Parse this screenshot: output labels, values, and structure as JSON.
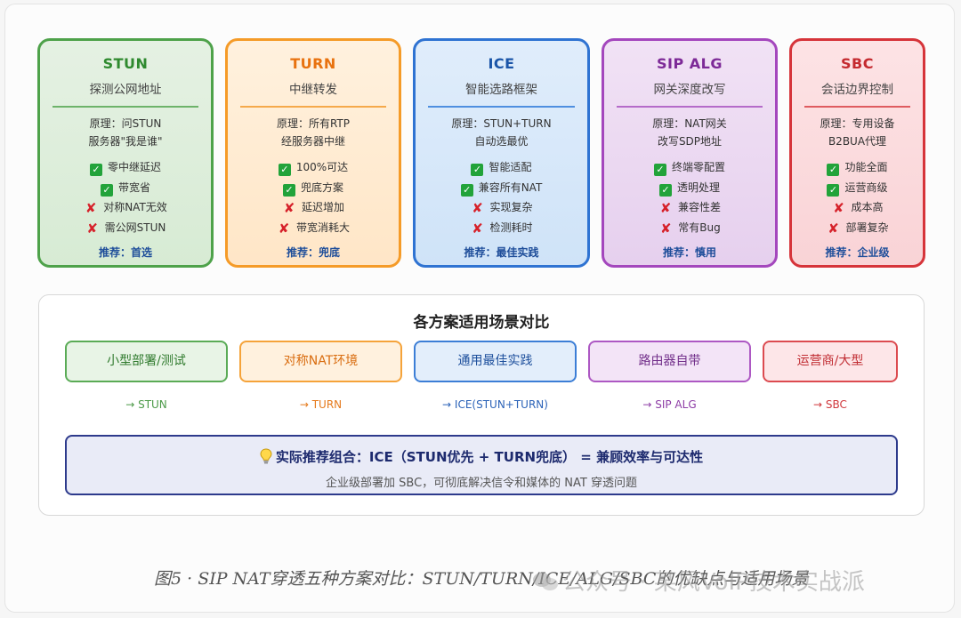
{
  "cards": [
    {
      "name": "STUN",
      "subtitle": "探测公网地址",
      "principle_1": "原理：问STUN",
      "principle_2": "服务器\"我是谁\"",
      "pros": [
        "零中继延迟",
        "带宽省"
      ],
      "cons": [
        "对称NAT无效",
        "需公网STUN"
      ],
      "recommend": "推荐：首选"
    },
    {
      "name": "TURN",
      "subtitle": "中继转发",
      "principle_1": "原理：所有RTP",
      "principle_2": "经服务器中继",
      "pros": [
        "100%可达",
        "兜底方案"
      ],
      "cons": [
        "延迟增加",
        "带宽消耗大"
      ],
      "recommend": "推荐：兜底"
    },
    {
      "name": "ICE",
      "subtitle": "智能选路框架",
      "principle_1": "原理：STUN+TURN",
      "principle_2": "自动选最优",
      "pros": [
        "智能适配",
        "兼容所有NAT"
      ],
      "cons": [
        "实现复杂",
        "检测耗时"
      ],
      "recommend": "推荐：最佳实践"
    },
    {
      "name": "SIP ALG",
      "subtitle": "网关深度改写",
      "principle_1": "原理：NAT网关",
      "principle_2": "改写SDP地址",
      "pros": [
        "终端零配置",
        "透明处理"
      ],
      "cons": [
        "兼容性差",
        "常有Bug"
      ],
      "recommend": "推荐：慎用"
    },
    {
      "name": "SBC",
      "subtitle": "会话边界控制",
      "principle_1": "原理：专用设备",
      "principle_2": "B2BUA代理",
      "pros": [
        "功能全面",
        "运营商级"
      ],
      "cons": [
        "成本高",
        "部署复杂"
      ],
      "recommend": "推荐：企业级"
    }
  ],
  "scenario": {
    "title": "各方案适用场景对比",
    "scenes": [
      "小型部署/测试",
      "对称NAT环境",
      "通用最佳实践",
      "路由器自带",
      "运营商/大型"
    ],
    "arrows": [
      "→ STUN",
      "→ TURN",
      "→ ICE(STUN+TURN)",
      "→ SIP ALG",
      "→ SBC"
    ]
  },
  "summary": {
    "main": "实际推荐组合：ICE（STUN优先 + TURN兜底） = 兼顾效率与可达性",
    "sub": "企业级部署加 SBC，可彻底解决信令和媒体的 NAT 穿透问题"
  },
  "caption": "图5 · SIP NAT穿透五种方案对比：STUN/TURN/ICE/ALG/SBC的优缺点与适用场景",
  "watermark": "公众号 · 某风VoIP技术实战派",
  "icons": {
    "pro": "check-box-icon",
    "con": "cross-icon",
    "summary": "lightbulb-icon"
  },
  "colors": {
    "stun": "#4ea24a",
    "turn": "#f59b28",
    "ice": "#2f73d2",
    "alg": "#a447bd",
    "sbc": "#d6343a",
    "summary_border": "#2d3a8c"
  }
}
